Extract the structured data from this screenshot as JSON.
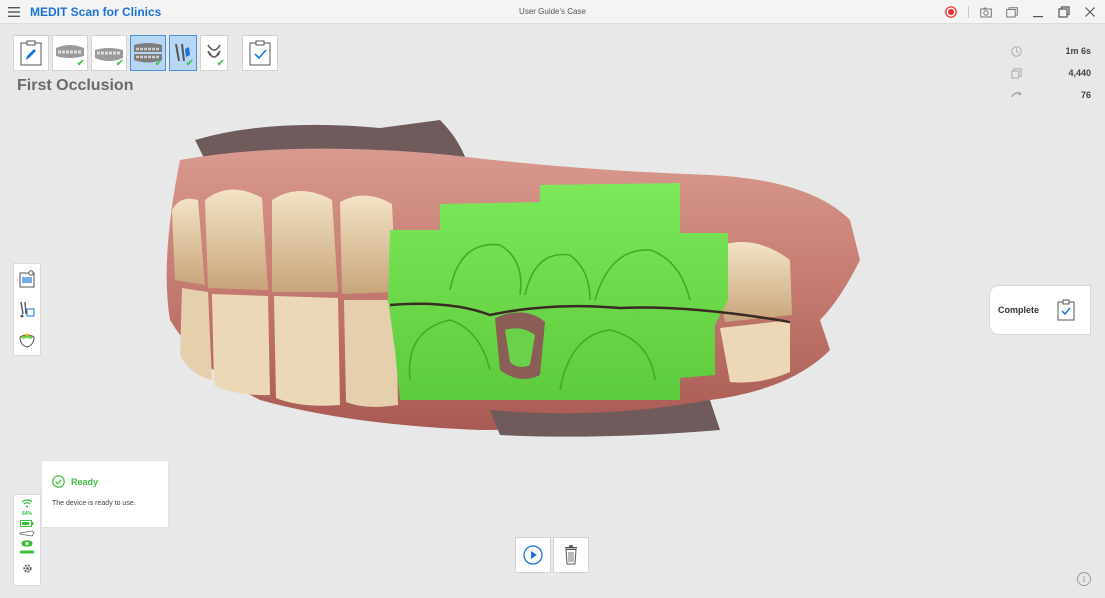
{
  "app": {
    "title": "MEDIT Scan for Clinics",
    "case_name": "User Guide's Case"
  },
  "window_controls": [
    "record-icon",
    "screenshot-icon",
    "window-icon",
    "minimize-icon",
    "maximize-icon",
    "close-icon"
  ],
  "stages": [
    {
      "name": "edit-info",
      "icon": "pencil-icon",
      "done": false,
      "active": false
    },
    {
      "name": "maxilla",
      "icon": "upper-jaw-icon",
      "done": true,
      "active": false
    },
    {
      "name": "mandible",
      "icon": "lower-jaw-icon",
      "done": true,
      "active": false
    },
    {
      "name": "occlusion",
      "icon": "occlusion-icon",
      "done": true,
      "active": true
    },
    {
      "name": "occlusion-2",
      "icon": "occlusion-side-icon",
      "done": true,
      "active": false
    },
    {
      "name": "occlusion-3",
      "icon": "occlusion-side-icon",
      "done": true,
      "active": false
    },
    {
      "name": "review",
      "icon": "clipboard-check-icon",
      "done": false,
      "active": false
    }
  ],
  "page_title": "First Occlusion",
  "stats": {
    "time": "1m 6s",
    "shots": "4,440",
    "rate": "76"
  },
  "complete_button": {
    "label": "Complete"
  },
  "status": {
    "title": "Ready",
    "description": "The device is ready to use.",
    "wifi_percent": "64%"
  },
  "colors": {
    "accent": "#1a73d9",
    "success": "#3cbf3c",
    "scan_highlight": "#6ee04e"
  }
}
